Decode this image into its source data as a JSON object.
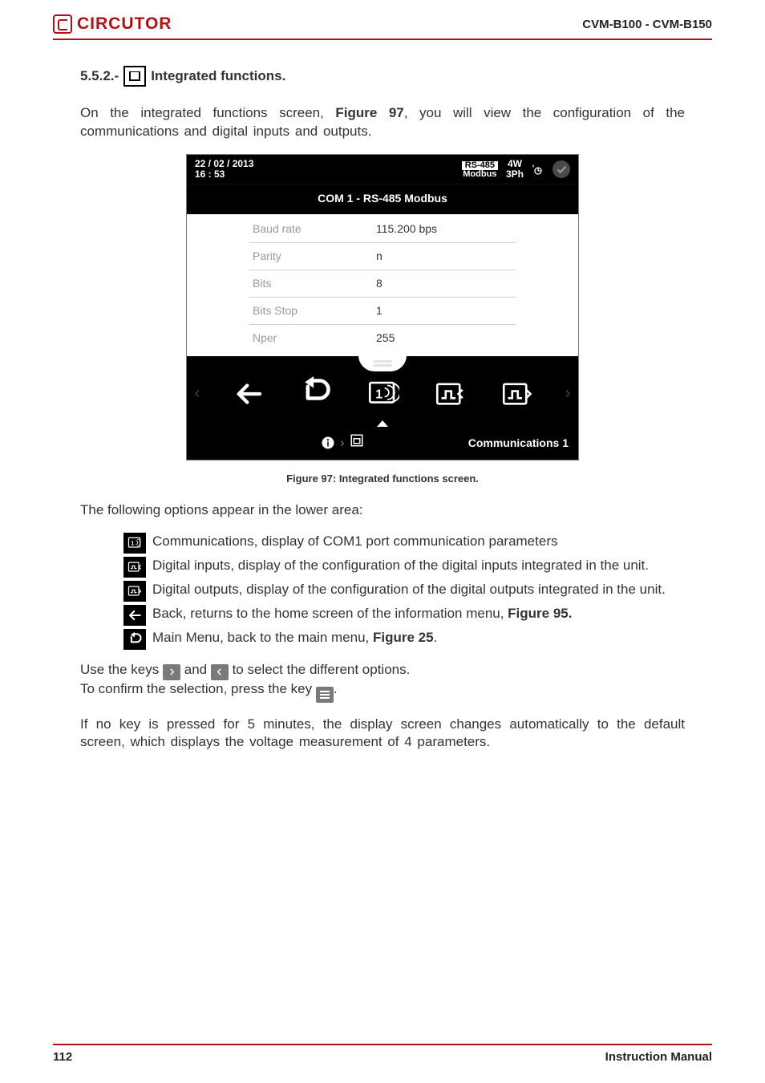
{
  "header": {
    "brand": "CIRCUTOR",
    "doc_id": "CVM-B100 - CVM-B150"
  },
  "section": {
    "number": "5.5.2.-",
    "title": "Integrated functions."
  },
  "intro_prefix": "On the integrated functions screen, ",
  "intro_figref": "Figure 97",
  "intro_suffix": ", you will view the configuration of the communications and digital inputs and outputs.",
  "device": {
    "date": "22 / 02 / 2013",
    "time": "16 : 53",
    "rs_label": "RS-485",
    "rs_proto": "Modbus",
    "wiring_top": "4W",
    "wiring_bottom": "3Ph",
    "panel_title": "COM 1 - RS-485 Modbus",
    "rows": [
      {
        "k": "Baud rate",
        "v": "115.200 bps"
      },
      {
        "k": "Parity",
        "v": "n"
      },
      {
        "k": "Bits",
        "v": "8"
      },
      {
        "k": "Bits Stop",
        "v": "1"
      },
      {
        "k": "Nper",
        "v": "255"
      }
    ],
    "footer_label": "Communications 1"
  },
  "caption": "Figure 97: Integrated functions screen.",
  "lower_intro": "The following options appear in the lower area:",
  "bullets": {
    "comm": "Communications, display of COM1 port communication parameters",
    "din": "Digital inputs, display of the configuration of the digital inputs integrated in the unit.",
    "dout": "Digital outputs, display of the configuration of the digital outputs integrated in the unit.",
    "back_pre": "Back, returns to the home screen of the information menu, ",
    "back_ref": "Figure 95.",
    "main_pre": "Main Menu, back to the main menu, ",
    "main_ref": "Figure 25",
    "main_post": "."
  },
  "keys_line_pre": "Use the keys ",
  "keys_line_mid": " and ",
  "keys_line_post": " to select the different options.",
  "confirm_pre": "To confirm the selection, press the key ",
  "confirm_post": ".",
  "timeout": "If no key is pressed for 5 minutes, the display screen changes automatically to the default screen, which displays the voltage measurement of 4 parameters.",
  "footer": {
    "page": "112",
    "label": "Instruction Manual"
  }
}
